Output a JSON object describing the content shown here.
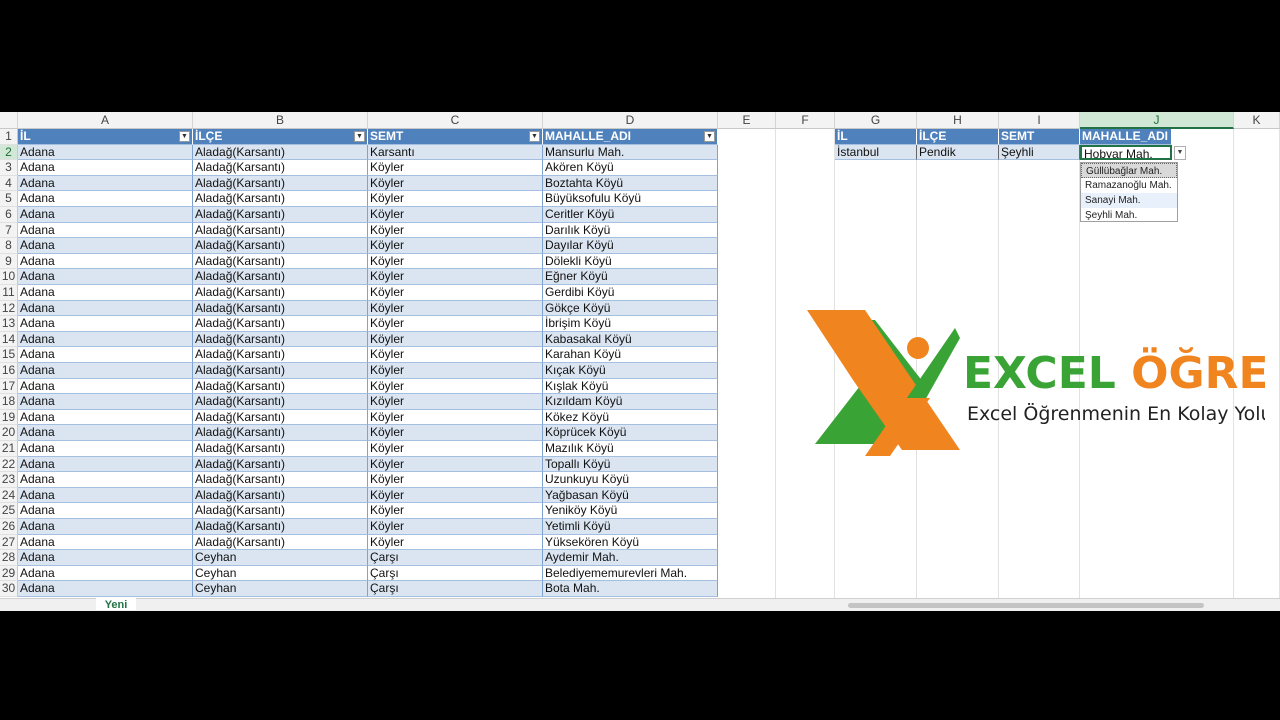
{
  "columns": [
    "A",
    "B",
    "C",
    "D",
    "E",
    "F",
    "G",
    "H",
    "I",
    "J",
    "K"
  ],
  "selected_column": "J",
  "row_numbers": [
    "1",
    "2",
    "3",
    "4",
    "5",
    "6",
    "7",
    "8",
    "9",
    "10",
    "11",
    "12",
    "13",
    "14",
    "15",
    "16",
    "17",
    "18",
    "19",
    "20",
    "21",
    "22",
    "23",
    "24",
    "25",
    "26",
    "27",
    "28",
    "29",
    "30"
  ],
  "selected_row": "2",
  "main_table": {
    "headers": [
      "İL",
      "İLÇE",
      "SEMT",
      "MAHALLE_ADI"
    ],
    "rows": [
      [
        "Adana",
        "Aladağ(Karsantı)",
        "Karsantı",
        "Mansurlu Mah."
      ],
      [
        "Adana",
        "Aladağ(Karsantı)",
        "Köyler",
        "Akören Köyü"
      ],
      [
        "Adana",
        "Aladağ(Karsantı)",
        "Köyler",
        "Boztahta Köyü"
      ],
      [
        "Adana",
        "Aladağ(Karsantı)",
        "Köyler",
        "Büyüksofulu Köyü"
      ],
      [
        "Adana",
        "Aladağ(Karsantı)",
        "Köyler",
        "Ceritler Köyü"
      ],
      [
        "Adana",
        "Aladağ(Karsantı)",
        "Köyler",
        "Darılık Köyü"
      ],
      [
        "Adana",
        "Aladağ(Karsantı)",
        "Köyler",
        "Dayılar Köyü"
      ],
      [
        "Adana",
        "Aladağ(Karsantı)",
        "Köyler",
        "Dölekli Köyü"
      ],
      [
        "Adana",
        "Aladağ(Karsantı)",
        "Köyler",
        "Eğner Köyü"
      ],
      [
        "Adana",
        "Aladağ(Karsantı)",
        "Köyler",
        "Gerdibi Köyü"
      ],
      [
        "Adana",
        "Aladağ(Karsantı)",
        "Köyler",
        "Gökçe Köyü"
      ],
      [
        "Adana",
        "Aladağ(Karsantı)",
        "Köyler",
        "İbrişim Köyü"
      ],
      [
        "Adana",
        "Aladağ(Karsantı)",
        "Köyler",
        "Kabasakal Köyü"
      ],
      [
        "Adana",
        "Aladağ(Karsantı)",
        "Köyler",
        "Karahan Köyü"
      ],
      [
        "Adana",
        "Aladağ(Karsantı)",
        "Köyler",
        "Kıçak Köyü"
      ],
      [
        "Adana",
        "Aladağ(Karsantı)",
        "Köyler",
        "Kışlak Köyü"
      ],
      [
        "Adana",
        "Aladağ(Karsantı)",
        "Köyler",
        "Kızıldam Köyü"
      ],
      [
        "Adana",
        "Aladağ(Karsantı)",
        "Köyler",
        "Kökez Köyü"
      ],
      [
        "Adana",
        "Aladağ(Karsantı)",
        "Köyler",
        "Köprücek Köyü"
      ],
      [
        "Adana",
        "Aladağ(Karsantı)",
        "Köyler",
        "Mazılık Köyü"
      ],
      [
        "Adana",
        "Aladağ(Karsantı)",
        "Köyler",
        "Topallı Köyü"
      ],
      [
        "Adana",
        "Aladağ(Karsantı)",
        "Köyler",
        "Uzunkuyu Köyü"
      ],
      [
        "Adana",
        "Aladağ(Karsantı)",
        "Köyler",
        "Yağbasan Köyü"
      ],
      [
        "Adana",
        "Aladağ(Karsantı)",
        "Köyler",
        "Yeniköy Köyü"
      ],
      [
        "Adana",
        "Aladağ(Karsantı)",
        "Köyler",
        "Yetimli Köyü"
      ],
      [
        "Adana",
        "Aladağ(Karsantı)",
        "Köyler",
        "Yüksekören Köyü"
      ],
      [
        "Adana",
        "Ceyhan",
        "Çarşı",
        "Aydemir Mah."
      ],
      [
        "Adana",
        "Ceyhan",
        "Çarşı",
        "Belediyememurevleri Mah."
      ],
      [
        "Adana",
        "Ceyhan",
        "Çarşı",
        "Bota Mah."
      ]
    ]
  },
  "lookup_table": {
    "headers": [
      "İL",
      "İLÇE",
      "SEMT",
      "MAHALLE_ADI"
    ],
    "row": [
      "İstanbul",
      "Pendik",
      "Şeyhli",
      "Hobyar Mah."
    ]
  },
  "dropdown": {
    "options": [
      "Güllübağlar Mah.",
      "Ramazanoğlu Mah.",
      "Sanayi Mah.",
      "Şeyhli Mah."
    ],
    "highlighted_index": 0,
    "hover_index": 2
  },
  "logo": {
    "title_part1": "EXCEL ",
    "title_part2": "ÖĞREN",
    "tagline": "Excel Öğrenmenin En Kolay Yolu",
    "green": "#3aa335",
    "orange": "#f0841e"
  },
  "sheet_tab": {
    "label": "Yeni"
  },
  "colors": {
    "header_blue": "#4f81bd",
    "band_blue": "#dbe5f1",
    "excel_green": "#217346"
  }
}
